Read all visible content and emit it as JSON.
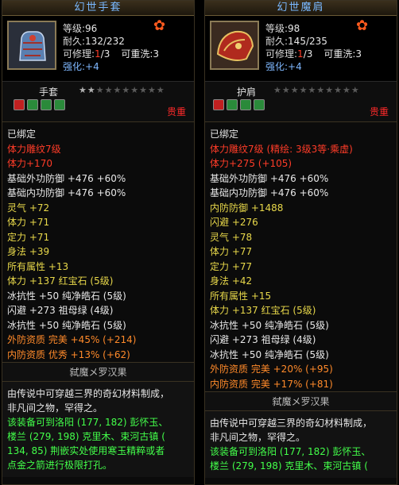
{
  "left": {
    "title": "幻世手套",
    "level_label": "等级:",
    "level": "96",
    "durability_label": "耐久:",
    "durability": "132/232",
    "repair_label": "可修理:",
    "repair_count": "1",
    "repair_max": "/3",
    "reforge": "可重洗:3",
    "enhance_label": "强化:",
    "enhance": "+4",
    "item_type": "手套",
    "stars": [
      "★",
      "★",
      "★",
      "★",
      "★",
      "★",
      "★",
      "★",
      "★",
      "★"
    ],
    "rarity": "贵重",
    "bound": "已绑定",
    "attributes": [
      {
        "text": "体力雕纹7级",
        "color": "#ff3c28"
      },
      {
        "text": "体力+170",
        "color": "#ff3c28"
      },
      {
        "text": "基础外功防御 +476 +60%",
        "color": "#e8e8e8"
      },
      {
        "text": "基础内功防御 +476 +60%",
        "color": "#e8e8e8"
      },
      {
        "text": "灵气 +72",
        "color": "#e8d84a"
      },
      {
        "text": "体力 +71",
        "color": "#e8d84a"
      },
      {
        "text": "定力 +71",
        "color": "#e8d84a"
      },
      {
        "text": "身法 +39",
        "color": "#e8d84a"
      },
      {
        "text": "所有属性 +13",
        "color": "#e8d84a"
      },
      {
        "text": "体力 +137 红宝石 (5级)",
        "color": "#e8d84a"
      },
      {
        "text": "冰抗性 +50 纯净皓石 (5级)",
        "color": "#e8e8e8"
      },
      {
        "text": "闪避 +273 祖母绿 (4级)",
        "color": "#e8e8e8"
      },
      {
        "text": "冰抗性 +50 纯净皓石 (5级)",
        "color": "#e8e8e8"
      },
      {
        "text": "外防资质   完美 +45% (+214)",
        "color": "#ff8a2a"
      },
      {
        "text": "内防资质   优秀 +13% (+62)",
        "color": "#ff8a2a"
      }
    ],
    "set_name": "弑魔メ罗汉果",
    "desc_lines": [
      {
        "text": "由传说中可穿越三界的奇幻材料制成，",
        "color": "#e8e8e8"
      },
      {
        "text": "非凡间之物，罕得之。",
        "color": "#e8e8e8"
      },
      {
        "text": "该装备可到洛阳 (177, 182) 彭怀玉、",
        "color": "#43ff4a"
      },
      {
        "text": "楼兰 (279, 198) 克里木、束河古镇 (",
        "color": "#43ff4a"
      },
      {
        "text": "134, 85) 荆嵌实处使用寒玉精粹或者",
        "color": "#43ff4a"
      },
      {
        "text": "点金之箭进行极限打孔。",
        "color": "#43ff4a"
      }
    ]
  },
  "right": {
    "title": "幻世魔肩",
    "level_label": "等级:",
    "level": "98",
    "durability_label": "耐久:",
    "durability": "145/235",
    "repair_label": "可修理:",
    "repair_count": "1",
    "repair_max": "/3",
    "reforge": "可重洗:3",
    "enhance_label": "强化:",
    "enhance": "+4",
    "item_type": "护肩",
    "stars": [
      "★",
      "★",
      "★",
      "★",
      "★",
      "★",
      "★",
      "★",
      "★",
      "★"
    ],
    "rarity": "贵重",
    "bound": "已绑定",
    "attributes": [
      {
        "text": "体力雕纹7级 (精绘: 3级3等·乘虚)",
        "color": "#ff3c28"
      },
      {
        "text": "体力+275 (+105)",
        "color": "#ff3c28"
      },
      {
        "text": "基础外功防御 +476 +60%",
        "color": "#e8e8e8"
      },
      {
        "text": "基础内功防御 +476 +60%",
        "color": "#e8e8e8"
      },
      {
        "text": "内防防御 +1488",
        "color": "#e8d84a"
      },
      {
        "text": "闪避 +276",
        "color": "#e8d84a"
      },
      {
        "text": "灵气 +78",
        "color": "#e8d84a"
      },
      {
        "text": "体力 +77",
        "color": "#e8d84a"
      },
      {
        "text": "定力 +77",
        "color": "#e8d84a"
      },
      {
        "text": "身法 +42",
        "color": "#e8d84a"
      },
      {
        "text": "所有属性 +15",
        "color": "#e8d84a"
      },
      {
        "text": "体力 +137 红宝石 (5级)",
        "color": "#e8d84a"
      },
      {
        "text": "冰抗性 +50 纯净皓石 (5级)",
        "color": "#e8e8e8"
      },
      {
        "text": "闪避 +273 祖母绿 (4级)",
        "color": "#e8e8e8"
      },
      {
        "text": "冰抗性 +50 纯净皓石 (5级)",
        "color": "#e8e8e8"
      },
      {
        "text": "外防资质   完美 +20% (+95)",
        "color": "#ff8a2a"
      },
      {
        "text": "内防资质   完美 +17% (+81)",
        "color": "#ff8a2a"
      }
    ],
    "set_name": "弑魔メ罗汉果",
    "desc_lines": [
      {
        "text": "由传说中可穿越三界的奇幻材料制成，",
        "color": "#e8e8e8"
      },
      {
        "text": "非凡间之物，罕得之。",
        "color": "#e8e8e8"
      },
      {
        "text": "该装备可到洛阳 (177, 182) 彭怀玉、",
        "color": "#43ff4a"
      },
      {
        "text": "楼兰 (279, 198) 克里木、束河古镇 (",
        "color": "#43ff4a"
      }
    ]
  },
  "gem_colors": [
    "#c02020",
    "#2a8a3a",
    "#2a8a3a",
    "#2a8a3a"
  ]
}
